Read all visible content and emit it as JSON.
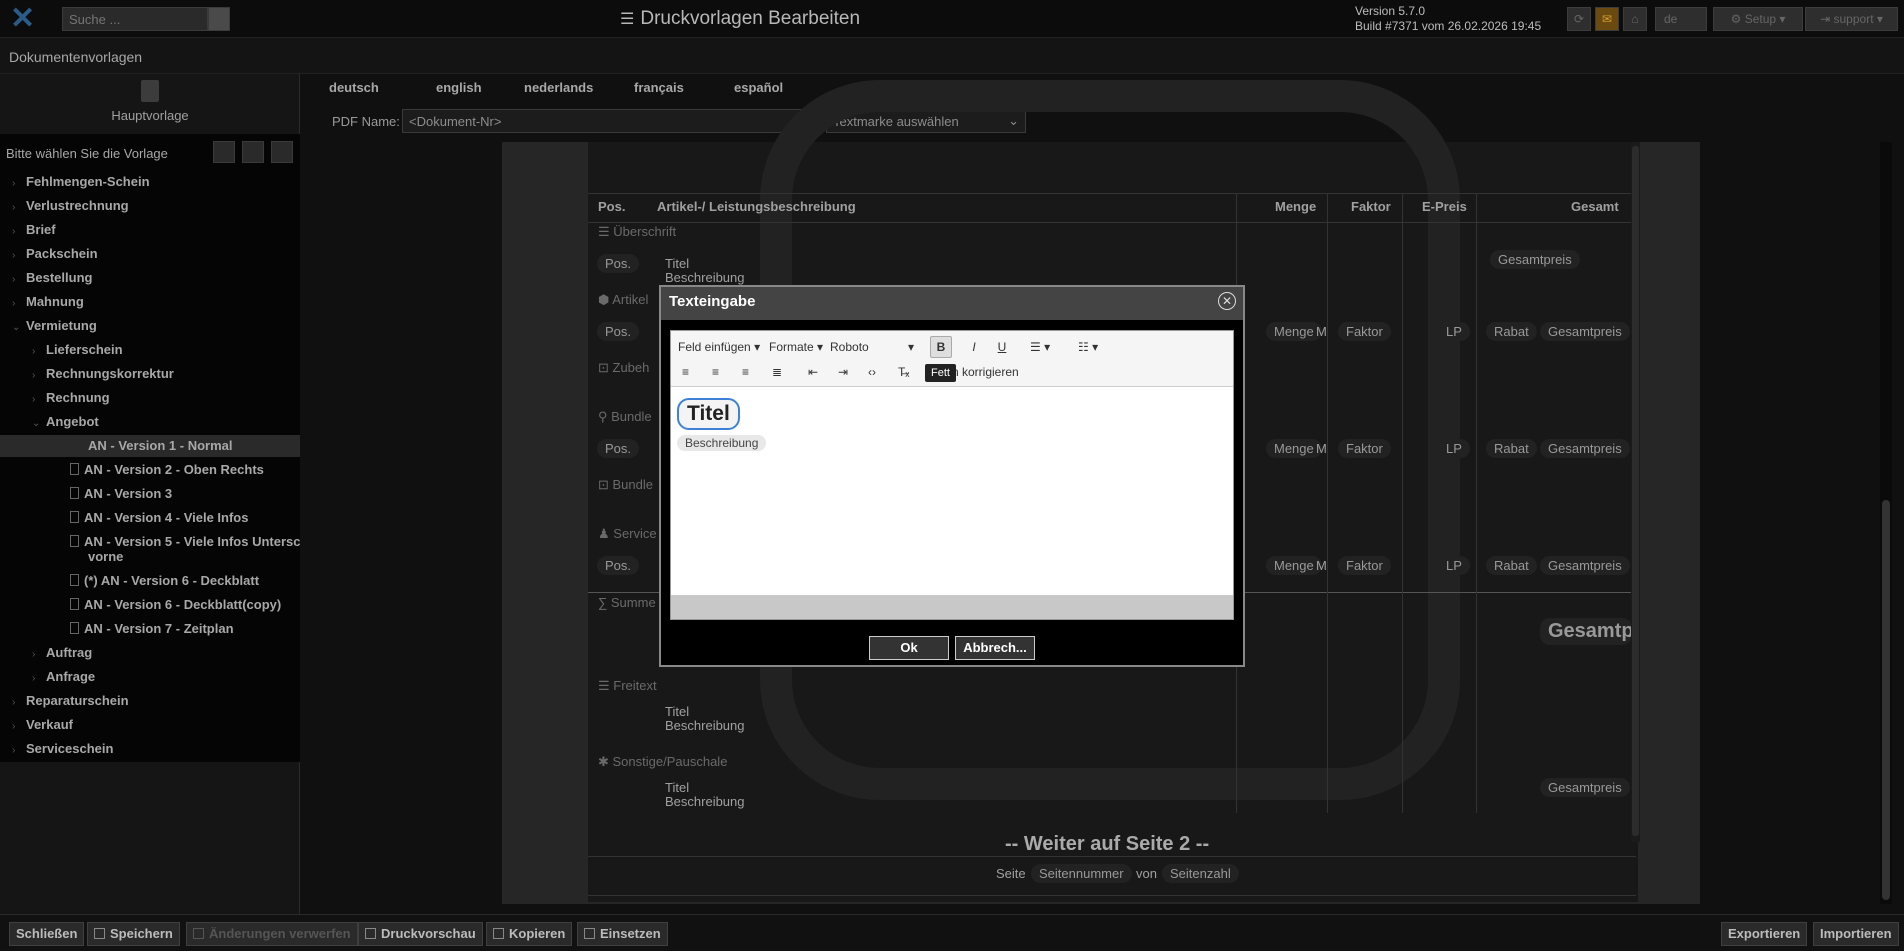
{
  "header": {
    "title": "Druckvorlagen Bearbeiten",
    "search_placeholder": "Suche ...",
    "version": "Version 5.7.0",
    "build": "Build #7371 vom 26.02.2026 19:45",
    "lang_button": "de",
    "setup_button": "Setup",
    "support_button": "support"
  },
  "docbar": {
    "title": "Dokumentenvorlagen"
  },
  "sidebar": {
    "main_template": "Hauptvorlage",
    "tree_header": "Bitte wählen Sie die Vorlage",
    "items": [
      "Fehlmengen-Schein",
      "Verlustrechnung",
      "Brief",
      "Packschein",
      "Bestellung",
      "Mahnung",
      "Vermietung",
      "Lieferschein",
      "Rechnungskorrektur",
      "Rechnung",
      "Angebot",
      "AN - Version 1 - Normal",
      "AN - Version 2 - Oben Rechts",
      "AN - Version 3",
      "AN - Version 4 - Viele Infos",
      "AN - Version 5 - Viele Infos Untersch",
      "vorne",
      "(*) AN - Version 6 - Deckblatt",
      "AN - Version 6 - Deckblatt(copy)",
      "AN - Version 7 - Zeitplan",
      "Auftrag",
      "Anfrage",
      "Reparaturschein",
      "Verkauf",
      "Serviceschein"
    ]
  },
  "languages": [
    "deutsch",
    "english",
    "nederlands",
    "français",
    "español"
  ],
  "pdf": {
    "label": "PDF Name:",
    "value": "<Dokument-Nr>",
    "textmark_placeholder": "Textmarke auswählen"
  },
  "table": {
    "headers": [
      "Pos.",
      "Artikel-/ Leistungsbeschreibung",
      "Menge",
      "Faktor",
      "E-Preis",
      "Gesamt"
    ],
    "sections": [
      "Überschrift",
      "Artikel",
      "Zubeh",
      "Bundle",
      "Bundle",
      "Service",
      "Summe",
      "Freitext",
      "Sonstige/Pauschale"
    ],
    "pos": "Pos.",
    "titel": "Titel",
    "beschreibung": "Beschreibung",
    "gesamtpreis": "Gesamtpreis",
    "menge": "Menge",
    "m": "M",
    "faktor": "Faktor",
    "lp": "LP",
    "rabat": "Rabat",
    "gesamt_big": "Gesamtp",
    "weiter": "-- Weiter auf Seite 2 --",
    "seite": "Seite",
    "seitennummer": "Seitennummer",
    "von": "von",
    "seitenzahl": "Seitenzahl"
  },
  "modal": {
    "title": "Texteingabe",
    "insert_field": "Feld einfügen",
    "formats": "Formate",
    "font": "Roboto",
    "bold_label": "B",
    "italic_label": "I",
    "underline_label": "U",
    "tooltip": "Fett",
    "correct_text": "n korrigieren",
    "content_title": "Titel",
    "content_desc": "Beschreibung",
    "ok": "Ok",
    "cancel": "Abbrech..."
  },
  "bottom": {
    "close": "Schließen",
    "save": "Speichern",
    "discard": "Änderungen verwerfen",
    "preview": "Druckvorschau",
    "copy": "Kopieren",
    "paste": "Einsetzen",
    "export": "Exportieren",
    "import": "Importieren"
  }
}
